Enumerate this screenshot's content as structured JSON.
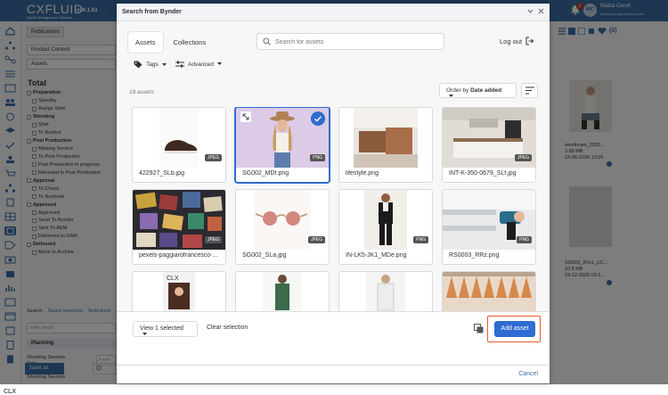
{
  "app": {
    "logo": "CXFLUID",
    "logo_tagline": "Media Management Solution",
    "version": "v26.1.63",
    "notification_count": "3",
    "user_initials": "MC",
    "user_name": "Mattia Ceruti",
    "user_email": "mattia.ceruti@eclexion.com",
    "footer_logo": "CLX"
  },
  "filters_panel": {
    "tab": "Publications",
    "field1": "Product Content",
    "field2": "Assets",
    "total_label": "Total",
    "items": [
      {
        "label": "Preparation",
        "type": "grp"
      },
      {
        "label": "Standby",
        "type": "sub"
      },
      {
        "label": "Assign View",
        "type": "sub"
      },
      {
        "label": "Shooting",
        "type": "grp"
      },
      {
        "label": "Shot",
        "type": "sub"
      },
      {
        "label": "To Reshot",
        "type": "sub"
      },
      {
        "label": "Post Production",
        "type": "grp"
      },
      {
        "label": "Missing Service",
        "type": "sub"
      },
      {
        "label": "To Post Production",
        "type": "sub"
      },
      {
        "label": "Post Production in progress",
        "type": "sub"
      },
      {
        "label": "Returned to Post Production",
        "type": "sub"
      },
      {
        "label": "Approval",
        "type": "grp"
      },
      {
        "label": "To Check",
        "type": "sub"
      },
      {
        "label": "To Recheck",
        "type": "sub"
      },
      {
        "label": "Approved",
        "type": "grp"
      },
      {
        "label": "Approved",
        "type": "sub"
      },
      {
        "label": "Send To Bynder",
        "type": "sub"
      },
      {
        "label": "Sent To AEM",
        "type": "sub"
      },
      {
        "label": "Delivered to DAM",
        "type": "sub"
      },
      {
        "label": "Delivered",
        "type": "grp"
      },
      {
        "label": "Move to Archive",
        "type": "sub"
      }
    ],
    "bottom_tabs": [
      "Search",
      "Saved searches",
      "Selections"
    ],
    "filter_placeholder": "Filter fields",
    "planning_label": "Planning",
    "shooting_session_date": "Shooting Session Date",
    "from_placeholder": "From",
    "shooting_session_2": "Shooting Session",
    "save_as": "Save as",
    "clear": "Cl"
  },
  "right_panel": {
    "count_label": "(0)",
    "items": [
      {
        "name": "seedream_2025...",
        "size": "2.89 MB",
        "date": "15-06-2026 12:05"
      },
      {
        "name": "SG003_3Vx1_UC...",
        "size": "10.8 MB",
        "date": "19-12-2025 09:2..."
      }
    ]
  },
  "modal": {
    "title": "Search from Bynder",
    "cancel": "Cancel"
  },
  "bynder": {
    "tabs": [
      "Assets",
      "Collections"
    ],
    "active_tab": "Assets",
    "search_placeholder": "Search for assets",
    "logout": "Log out",
    "tags_label": "Tags",
    "advanced_label": "Advanced",
    "asset_count": "19 assets",
    "order_prefix": "Order by",
    "order_value": "Date added",
    "view_selected": "View 1 selected",
    "clear_selection": "Clear selection",
    "add_asset": "Add asset"
  },
  "assets": [
    {
      "name": "422927_SLb.jpg",
      "type": "JPEG",
      "selected": false
    },
    {
      "name": "SG002_MDf.png",
      "type": "PNG",
      "selected": true
    },
    {
      "name": "lifestyle.png",
      "type": "",
      "selected": false
    },
    {
      "name": "INT-K-350-0679_SLf.jpg",
      "type": "JPEG",
      "selected": false
    },
    {
      "name": "pexels-paggiarofrancesco-...",
      "type": "JPEG",
      "selected": false
    },
    {
      "name": "SG002_SLa.jpg",
      "type": "JPEG",
      "selected": false
    },
    {
      "name": "IN-LK5-JK1_MDe.png",
      "type": "PNG",
      "selected": false
    },
    {
      "name": "RS0003_RRz.png",
      "type": "PNG",
      "selected": false
    },
    {
      "name": "",
      "type": "",
      "selected": false
    },
    {
      "name": "",
      "type": "",
      "selected": false
    },
    {
      "name": "",
      "type": "",
      "selected": false
    },
    {
      "name": "",
      "type": "",
      "selected": false
    }
  ]
}
